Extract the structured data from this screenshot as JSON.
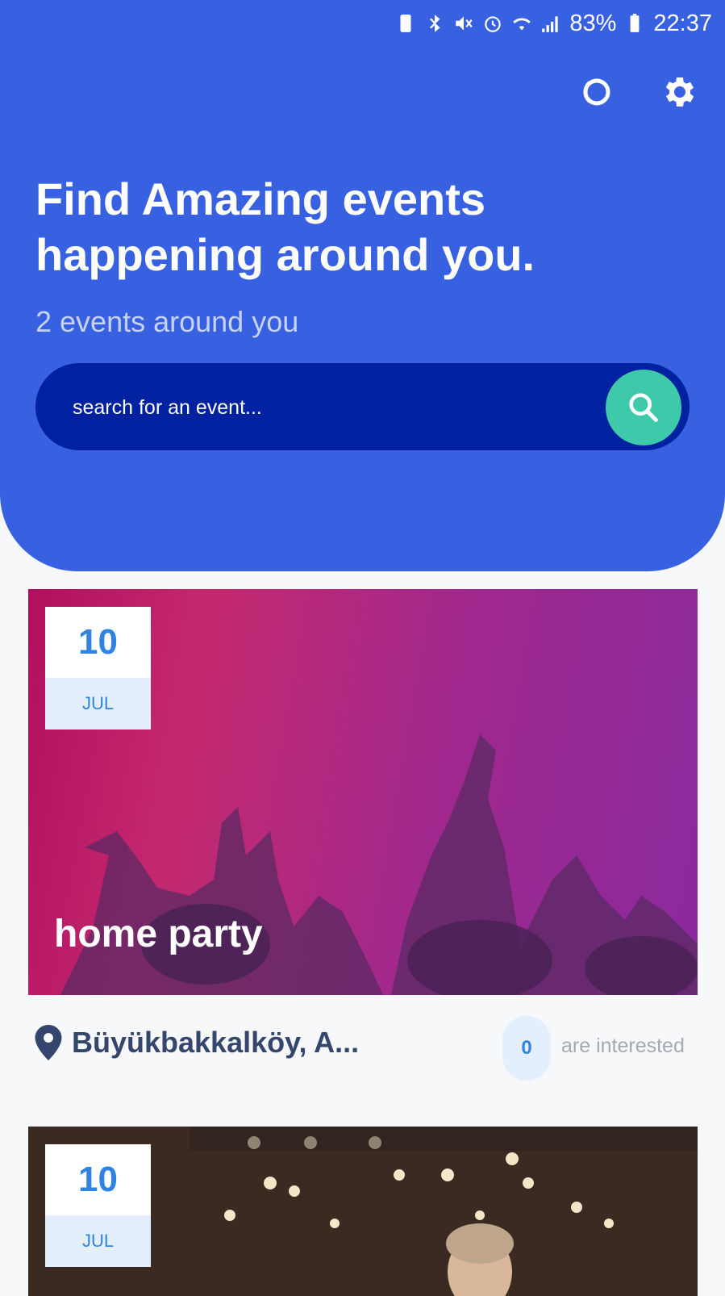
{
  "status_bar": {
    "battery": "83%",
    "time": "22:37"
  },
  "header": {
    "headline": "Find Amazing events happening around you.",
    "subtitle": "2 events around you"
  },
  "search": {
    "placeholder": "search for an event..."
  },
  "events": [
    {
      "day": "10",
      "month": "JUL",
      "title": "home party",
      "location": "Büyükbakkalköy, A...",
      "interested_count": "0",
      "interested_label": "are interested"
    },
    {
      "day": "10",
      "month": "JUL"
    }
  ],
  "colors": {
    "header_bg": "#3861e2",
    "search_bg": "#0021a0",
    "search_button": "#3ec9aa",
    "accent_blue": "#2f84e3"
  },
  "icons": {
    "top_left": "loading-ring-icon",
    "top_right": "gear-icon",
    "search_button": "search-icon",
    "location": "location-pin-icon"
  }
}
